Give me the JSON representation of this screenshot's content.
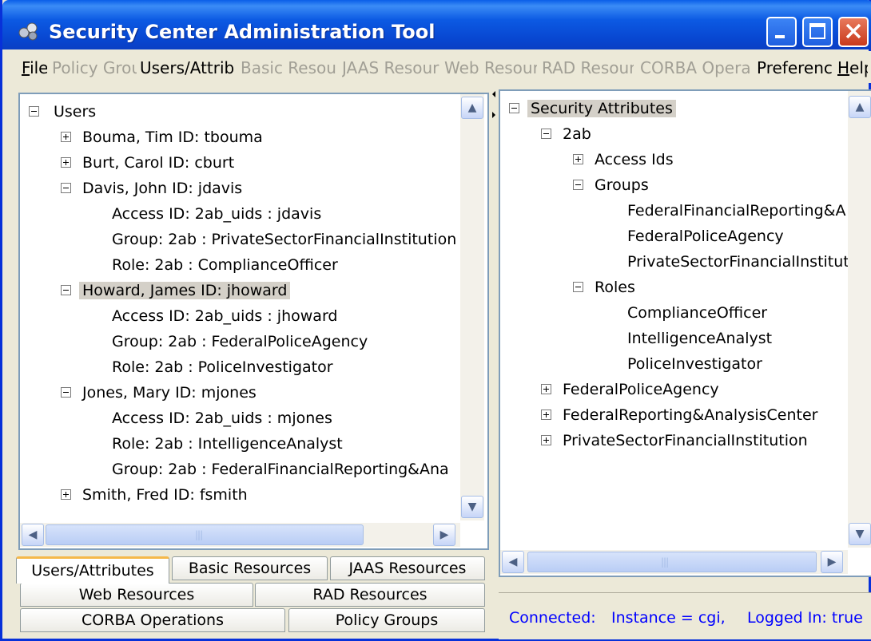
{
  "window": {
    "title": "Security Center Administration Tool"
  },
  "menubar": {
    "items": [
      {
        "label": "File",
        "mnemonic": "F",
        "rest": "ile",
        "enabled": true
      },
      {
        "label": "Policy Grou",
        "enabled": false
      },
      {
        "label": "Users/Attrib",
        "enabled": true
      },
      {
        "label": "Basic Resour",
        "enabled": false
      },
      {
        "label": "JAAS Resour",
        "enabled": false
      },
      {
        "label": "Web Resour",
        "enabled": false
      },
      {
        "label": "RAD Resour",
        "enabled": false
      },
      {
        "label": "CORBA Opera",
        "enabled": false
      },
      {
        "label": "Preferenc",
        "enabled": true
      },
      {
        "label": "Help",
        "mnemonic": "H",
        "rest": "elp",
        "enabled": true
      }
    ]
  },
  "users_tree": {
    "root": "Users",
    "rows": [
      {
        "label": "Bouma, Tim   ID: tbouma"
      },
      {
        "label": "Burt, Carol   ID: cburt"
      },
      {
        "label": "Davis, John   ID: jdavis"
      },
      {
        "label": "Access ID: 2ab_uids : jdavis"
      },
      {
        "label": "Group: 2ab : PrivateSectorFinancialInstitution"
      },
      {
        "label": "Role: 2ab : ComplianceOfficer"
      },
      {
        "label": "Howard, James   ID: jhoward"
      },
      {
        "label": "Access ID: 2ab_uids : jhoward"
      },
      {
        "label": "Group: 2ab : FederalPoliceAgency"
      },
      {
        "label": "Role: 2ab : PoliceInvestigator"
      },
      {
        "label": "Jones, Mary   ID: mjones"
      },
      {
        "label": "Access ID: 2ab_uids : mjones"
      },
      {
        "label": "Role: 2ab : IntelligenceAnalyst"
      },
      {
        "label": "Group: 2ab : FederalFinancialReporting&Ana"
      },
      {
        "label": "Smith, Fred   ID: fsmith"
      }
    ]
  },
  "attributes_tree": {
    "root": "Security Attributes",
    "rows": [
      {
        "label": "2ab"
      },
      {
        "label": "Access Ids"
      },
      {
        "label": "Groups"
      },
      {
        "label": "FederalFinancialReporting&A"
      },
      {
        "label": "FederalPoliceAgency"
      },
      {
        "label": "PrivateSectorFinancialInstitut"
      },
      {
        "label": "Roles"
      },
      {
        "label": "ComplianceOfficer"
      },
      {
        "label": "IntelligenceAnalyst"
      },
      {
        "label": "PoliceInvestigator"
      },
      {
        "label": "FederalPoliceAgency"
      },
      {
        "label": "FederalReporting&AnalysisCenter"
      },
      {
        "label": "PrivateSectorFinancialInstitution"
      }
    ]
  },
  "tabs": {
    "users_attributes": "Users/Attributes",
    "basic_resources": "Basic Resources",
    "jaas_resources": "JAAS Resources",
    "web_resources": "Web Resources",
    "rad_resources": "RAD Resources",
    "corba_operations": "CORBA Operations",
    "policy_groups": "Policy Groups"
  },
  "status": {
    "connected": "Connected:",
    "instance": "Instance = cgi,",
    "logged_in": "Logged In: true"
  },
  "scrollbar": {
    "grip": "|||"
  }
}
